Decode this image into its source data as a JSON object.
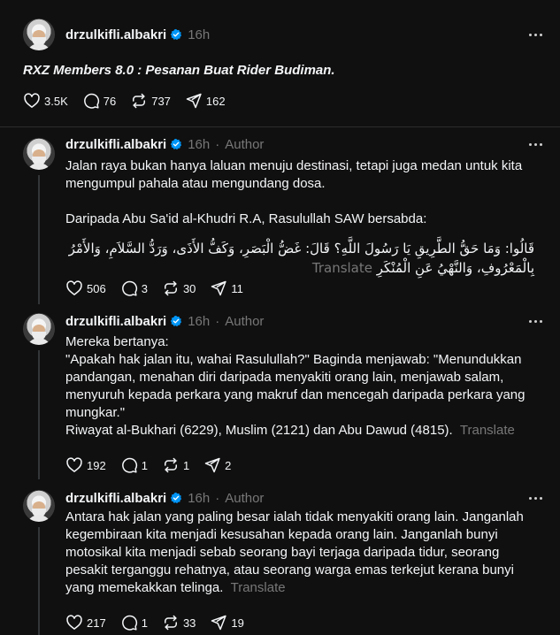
{
  "posts": [
    {
      "username": "drzulkifli.albakri",
      "time": "16h",
      "title": "RXZ Members 8.0 : Pesanan Buat Rider Budiman.",
      "likes": "3.5K",
      "replies": "76",
      "reposts": "737",
      "shares": "162"
    },
    {
      "username": "drzulkifli.albakri",
      "time": "16h",
      "sep": "·",
      "author": "Author",
      "para1": "Jalan raya bukan hanya laluan menuju destinasi, tetapi juga medan untuk kita mengumpul pahala atau mengundang dosa.",
      "para2": "Daripada Abu Sa'id al-Khudri R.A, Rasulullah SAW bersabda:",
      "arabic": "قَالُوا: وَمَا حَقُّ الطَّرِيقِ يَا رَسُولَ اللَّهِ؟ قَالَ: غَضُّ الْبَصَرِ، وَكَفُّ الأَذَى، وَرَدُّ السَّلاَمِ، وَالأَمْرُ بِالْمَعْرُوفِ، وَالنَّهْيُ عَنِ الْمُنْكَرِ",
      "translate": "Translate",
      "likes": "506",
      "replies": "3",
      "reposts": "30",
      "shares": "11"
    },
    {
      "username": "drzulkifli.albakri",
      "time": "16h",
      "sep": "·",
      "author": "Author",
      "line1": "Mereka bertanya:",
      "quote": "\"Apakah hak jalan itu, wahai Rasulullah?\" Baginda menjawab: \"Menundukkan pandangan, menahan diri daripada menyakiti orang lain, menjawab salam, menyuruh kepada perkara yang makruf dan mencegah daripada perkara yang mungkar.\"",
      "source": "Riwayat al-Bukhari (6229), Muslim (2121) dan Abu Dawud (4815).",
      "translate": "Translate",
      "likes": "192",
      "replies": "1",
      "reposts": "1",
      "shares": "2"
    },
    {
      "username": "drzulkifli.albakri",
      "time": "16h",
      "sep": "·",
      "author": "Author",
      "body": "Antara hak jalan yang paling besar ialah tidak menyakiti orang lain. Janganlah kegembiraan kita menjadi kesusahan kepada orang lain. Janganlah bunyi motosikal kita menjadi sebab seorang bayi terjaga daripada tidur, seorang pesakit terganggu rehatnya, atau seorang warga emas terkejut kerana bunyi yang memekakkan telinga.",
      "translate": "Translate",
      "likes": "217",
      "replies": "1",
      "reposts": "33",
      "shares": "19"
    }
  ],
  "icons": {
    "verified": "verified-badge-icon",
    "more": "more-options-icon",
    "like": "heart-icon",
    "reply": "comment-icon",
    "repost": "repost-icon",
    "share": "share-icon"
  },
  "colors": {
    "background": "#101010",
    "text": "#f3f5f7",
    "muted": "#777777",
    "verified": "#0095f6",
    "divider": "#2d2d2d"
  }
}
